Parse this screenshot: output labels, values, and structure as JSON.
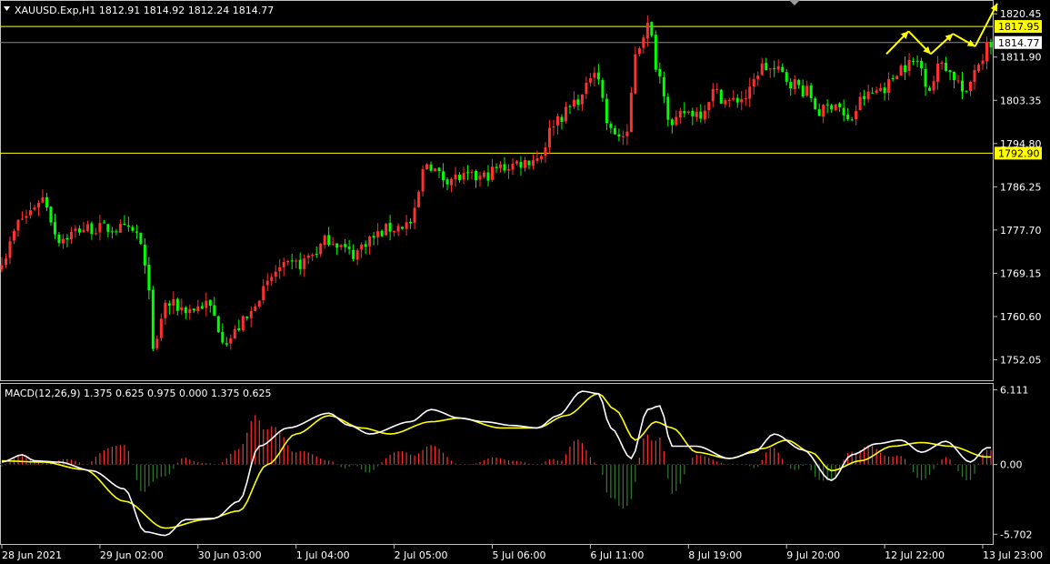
{
  "header": {
    "symbol_line": "XAUUSD.Exp,H1  1812.91 1814.92 1812.24 1814.77"
  },
  "colors": {
    "background": "#000000",
    "bull": "#ff3030",
    "bear": "#00ff00",
    "level": "#ffff00",
    "macd_line": "#ffffff",
    "signal_line": "#ffff00",
    "hist_pos": "#ff3030",
    "hist_neg": "#2e7d32",
    "axis": "#c0c0c0"
  },
  "chart_data": {
    "type": "candlestick",
    "price": {
      "ylim": [
        1748.0,
        1823.0
      ],
      "ticks": [
        "1820.45",
        "1811.90",
        "1803.35",
        "1794.80",
        "1786.25",
        "1777.70",
        "1769.15",
        "1760.60",
        "1752.05"
      ],
      "tick_values": [
        1820.45,
        1811.9,
        1803.35,
        1794.8,
        1786.25,
        1777.7,
        1769.15,
        1760.6,
        1752.05
      ],
      "levels": [
        {
          "label": "1817.95",
          "value": 1817.95
        },
        {
          "label": "1792.90",
          "value": 1792.9
        }
      ],
      "current": {
        "label": "1814.77",
        "value": 1814.77
      },
      "anchors": [
        [
          0,
          1772
        ],
        [
          5,
          1780
        ],
        [
          10,
          1784
        ],
        [
          14,
          1776
        ],
        [
          20,
          1778
        ],
        [
          28,
          1778
        ],
        [
          33,
          1777
        ],
        [
          36,
          1767
        ],
        [
          37,
          1753
        ],
        [
          40,
          1763
        ],
        [
          46,
          1762
        ],
        [
          50,
          1763
        ],
        [
          55,
          1756
        ],
        [
          60,
          1760
        ],
        [
          63,
          1765
        ],
        [
          68,
          1770
        ],
        [
          73,
          1771
        ],
        [
          76,
          1773
        ],
        [
          80,
          1776
        ],
        [
          86,
          1773
        ],
        [
          90,
          1776
        ],
        [
          95,
          1778
        ],
        [
          100,
          1779
        ],
        [
          104,
          1791
        ],
        [
          108,
          1788
        ],
        [
          113,
          1788
        ],
        [
          117,
          1788
        ],
        [
          122,
          1790
        ],
        [
          127,
          1791
        ],
        [
          131,
          1792
        ],
        [
          136,
          1800
        ],
        [
          142,
          1804
        ],
        [
          145,
          1810
        ],
        [
          149,
          1797
        ],
        [
          153,
          1796
        ],
        [
          155,
          1813
        ],
        [
          158,
          1818
        ],
        [
          161,
          1808
        ],
        [
          164,
          1798
        ],
        [
          167,
          1801
        ],
        [
          171,
          1801
        ],
        [
          174,
          1805
        ],
        [
          178,
          1803
        ],
        [
          182,
          1804
        ],
        [
          186,
          1810
        ],
        [
          190,
          1809
        ],
        [
          193,
          1807
        ],
        [
          197,
          1805
        ],
        [
          200,
          1801
        ],
        [
          204,
          1803
        ],
        [
          207,
          1799
        ],
        [
          211,
          1804
        ],
        [
          216,
          1806
        ],
        [
          220,
          1810
        ],
        [
          224,
          1811
        ],
        [
          227,
          1806
        ],
        [
          230,
          1811
        ],
        [
          233,
          1808
        ],
        [
          236,
          1804
        ],
        [
          238,
          1810
        ],
        [
          242,
          1814.77
        ]
      ],
      "arrows": [
        [
          1812.5,
          1817.0
        ],
        [
          1817.0,
          1812.5
        ],
        [
          1812.5,
          1816.5
        ],
        [
          1816.5,
          1814.0
        ],
        [
          1814.0,
          1822.5
        ]
      ]
    },
    "macd": {
      "label": "MACD(12,26,9) 1.375 0.625 0.975 0.000 1.375 0.625",
      "ylim": [
        -6.5,
        6.6
      ],
      "ticks": [
        "6.111",
        "0.00",
        "-5.702"
      ],
      "tick_values": [
        6.111,
        0.0,
        -5.702
      ],
      "macd_anchors": [
        [
          0,
          0.2
        ],
        [
          5,
          0.8
        ],
        [
          8,
          0.3
        ],
        [
          14,
          0.2
        ],
        [
          22,
          -0.5
        ],
        [
          30,
          -2.0
        ],
        [
          35,
          -5.5
        ],
        [
          40,
          -5.8
        ],
        [
          45,
          -4.5
        ],
        [
          52,
          -4.4
        ],
        [
          58,
          -3.0
        ],
        [
          63,
          1.5
        ],
        [
          70,
          3.0
        ],
        [
          80,
          4.2
        ],
        [
          85,
          3.2
        ],
        [
          90,
          2.5
        ],
        [
          100,
          3.5
        ],
        [
          105,
          4.5
        ],
        [
          112,
          3.8
        ],
        [
          118,
          3.5
        ],
        [
          125,
          3.2
        ],
        [
          131,
          3.0
        ],
        [
          136,
          4.0
        ],
        [
          142,
          6.0
        ],
        [
          146,
          5.8
        ],
        [
          149,
          3.0
        ],
        [
          154,
          0.5
        ],
        [
          158,
          4.5
        ],
        [
          161,
          4.8
        ],
        [
          164,
          1.5
        ],
        [
          170,
          1.5
        ],
        [
          178,
          0.5
        ],
        [
          184,
          1.0
        ],
        [
          189,
          2.5
        ],
        [
          196,
          1.2
        ],
        [
          203,
          -1.3
        ],
        [
          208,
          0.8
        ],
        [
          214,
          1.7
        ],
        [
          220,
          2.0
        ],
        [
          225,
          1.0
        ],
        [
          231,
          1.9
        ],
        [
          237,
          0.2
        ],
        [
          241,
          1.375
        ]
      ],
      "signal_anchors": [
        [
          0,
          0.3
        ],
        [
          10,
          0.2
        ],
        [
          20,
          -0.4
        ],
        [
          30,
          -3.0
        ],
        [
          40,
          -5.2
        ],
        [
          50,
          -4.5
        ],
        [
          58,
          -3.8
        ],
        [
          65,
          0.0
        ],
        [
          72,
          2.5
        ],
        [
          80,
          4.0
        ],
        [
          88,
          3.0
        ],
        [
          95,
          2.5
        ],
        [
          105,
          3.5
        ],
        [
          112,
          3.8
        ],
        [
          122,
          3.0
        ],
        [
          131,
          3.0
        ],
        [
          138,
          4.0
        ],
        [
          146,
          5.8
        ],
        [
          150,
          4.5
        ],
        [
          155,
          2.0
        ],
        [
          160,
          3.5
        ],
        [
          164,
          3.0
        ],
        [
          170,
          1.0
        ],
        [
          178,
          0.5
        ],
        [
          186,
          1.3
        ],
        [
          192,
          2.0
        ],
        [
          198,
          1.0
        ],
        [
          203,
          -0.5
        ],
        [
          210,
          0.3
        ],
        [
          218,
          1.5
        ],
        [
          225,
          1.8
        ],
        [
          232,
          1.5
        ],
        [
          241,
          0.625
        ]
      ]
    },
    "x_axis": {
      "labels": [
        {
          "text": "28 Jun 2021",
          "i": 0
        },
        {
          "text": "29 Jun 02:00",
          "i": 24
        },
        {
          "text": "30 Jun 03:00",
          "i": 48
        },
        {
          "text": "1 Jul 04:00",
          "i": 72
        },
        {
          "text": "2 Jul 05:00",
          "i": 96
        },
        {
          "text": "5 Jul 06:00",
          "i": 120
        },
        {
          "text": "6 Jul 11:00",
          "i": 144
        },
        {
          "text": "8 Jul 19:00",
          "i": 168
        },
        {
          "text": "9 Jul 20:00",
          "i": 192
        },
        {
          "text": "12 Jul 22:00",
          "i": 216
        },
        {
          "text": "13 Jul 23:00",
          "i": 240
        }
      ]
    },
    "bar_count": 243
  }
}
